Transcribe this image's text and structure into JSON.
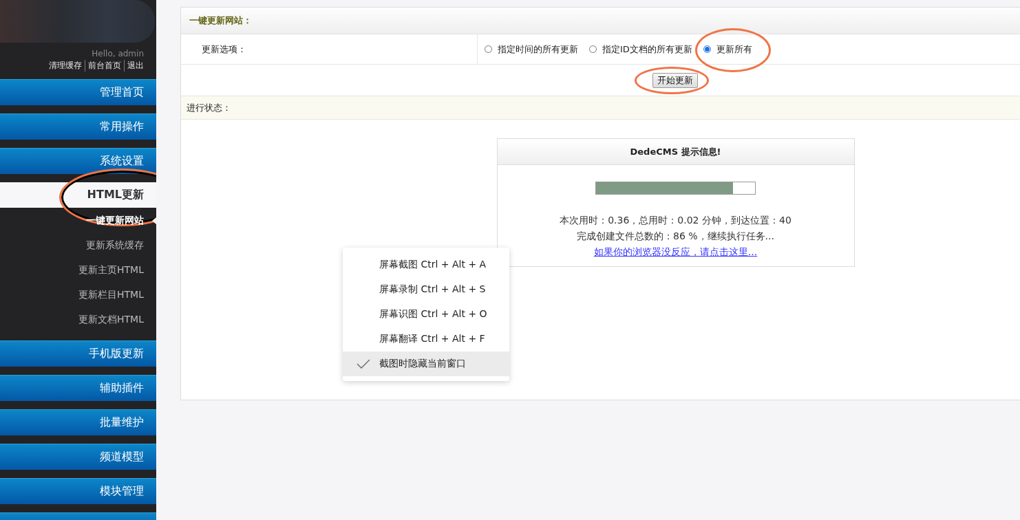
{
  "sidebar": {
    "greeting": "Hello, admin",
    "links": [
      "清理缓存",
      "前台首页",
      "退出"
    ],
    "items": [
      {
        "label": "管理首页",
        "expanded": false,
        "circled": false
      },
      {
        "label": "常用操作",
        "expanded": false,
        "circled": false
      },
      {
        "label": "系统设置",
        "expanded": false,
        "circled": false
      },
      {
        "label": "HTML更新",
        "expanded": true,
        "circled": true,
        "children": [
          {
            "label": "一键更新网站",
            "selected": true
          },
          {
            "label": "更新系统缓存",
            "selected": false
          },
          {
            "label": "更新主页HTML",
            "selected": false
          },
          {
            "label": "更新栏目HTML",
            "selected": false
          },
          {
            "label": "更新文档HTML",
            "selected": false
          }
        ]
      },
      {
        "label": "手机版更新",
        "expanded": false,
        "circled": false
      },
      {
        "label": "辅助插件",
        "expanded": false,
        "circled": false
      },
      {
        "label": "批量维护",
        "expanded": false,
        "circled": false
      },
      {
        "label": "频道模型",
        "expanded": false,
        "circled": false
      },
      {
        "label": "模块管理",
        "expanded": false,
        "circled": false
      }
    ]
  },
  "panel": {
    "title": "一键更新网站：",
    "option_label": "更新选项：",
    "options": [
      {
        "label": "指定时间的所有更新",
        "selected": false,
        "circled": false
      },
      {
        "label": "指定ID文档的所有更新",
        "selected": false,
        "circled": false
      },
      {
        "label": "更新所有",
        "selected": true,
        "circled": true
      }
    ],
    "button": {
      "label": "开始更新",
      "circled": true
    },
    "status_label": "进行状态：",
    "dialog": {
      "title": "DedeCMS 提示信息!",
      "level": 0.86,
      "lines": [
        "本次用时：0.36，总用时：0.02 分钟，到达位置：40",
        "完成创建文件总数的：86 %，继续执行任务..."
      ],
      "link": "如果你的浏览器没反应，请点击这里..."
    }
  },
  "context_menu": [
    {
      "label": "屏幕截图 Ctrl + Alt + A",
      "checked": false,
      "selected": false
    },
    {
      "label": "屏幕录制 Ctrl + Alt + S",
      "checked": false,
      "selected": false
    },
    {
      "label": "屏幕识图 Ctrl + Alt + O",
      "checked": false,
      "selected": false
    },
    {
      "label": "屏幕翻译 Ctrl + Alt + F",
      "checked": false,
      "selected": false
    },
    {
      "label": "截图时隐藏当前窗口",
      "checked": true,
      "selected": true
    }
  ]
}
